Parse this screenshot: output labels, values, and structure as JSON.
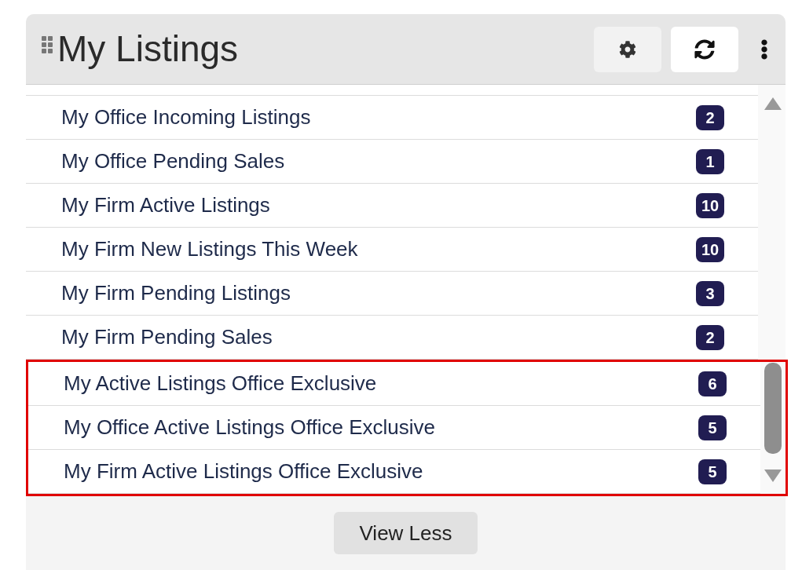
{
  "panel": {
    "title": "My Listings"
  },
  "rows": [
    {
      "label": "My Office Incoming Listings",
      "count": "2",
      "highlighted": false
    },
    {
      "label": "My Office Pending Sales",
      "count": "1",
      "highlighted": false
    },
    {
      "label": "My Firm Active Listings",
      "count": "10",
      "highlighted": false
    },
    {
      "label": "My Firm New Listings This Week",
      "count": "10",
      "highlighted": false
    },
    {
      "label": "My Firm Pending Listings",
      "count": "3",
      "highlighted": false
    },
    {
      "label": "My Firm Pending Sales",
      "count": "2",
      "highlighted": false
    },
    {
      "label": "My Active Listings Office Exclusive",
      "count": "6",
      "highlighted": true
    },
    {
      "label": "My Office Active Listings Office Exclusive",
      "count": "5",
      "highlighted": true
    },
    {
      "label": "My Firm Active Listings Office Exclusive",
      "count": "5",
      "highlighted": true
    }
  ],
  "footer": {
    "button": "View Less"
  }
}
